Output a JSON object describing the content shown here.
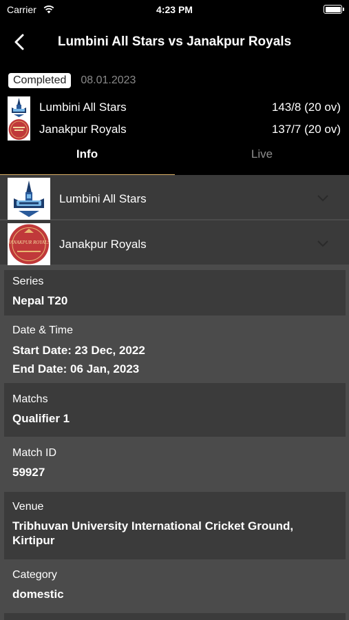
{
  "status_bar": {
    "carrier": "Carrier",
    "time": "4:23 PM"
  },
  "nav": {
    "title": "Lumbini All Stars vs Janakpur Royals"
  },
  "match": {
    "status": "Completed",
    "date": "08.01.2023",
    "teams": [
      {
        "name": "Lumbini All Stars",
        "score": "143/8 (20 ov)"
      },
      {
        "name": "Janakpur Royals",
        "score": "137/7 (20 ov)"
      }
    ]
  },
  "tabs": [
    {
      "label": "Info"
    },
    {
      "label": "Live"
    }
  ],
  "logos": {
    "janakpur_text": "JANAKPUR ROYALS"
  },
  "info": {
    "series_label": "Series",
    "series_value": "Nepal T20",
    "datetime_label": "Date & Time",
    "start_date": "Start Date: 23 Dec, 2022",
    "end_date": "End Date: 06 Jan, 2023",
    "matchs_label": "Matchs",
    "matchs_value": "Qualifier 1",
    "match_id_label": "Match ID",
    "match_id_value": "59927",
    "venue_label": "Venue",
    "venue_value": "Tribhuvan University International Cricket Ground, Kirtipur",
    "category_label": "Category",
    "category_value": "domestic"
  },
  "colors": {
    "tab_indicator": "#e0b46a",
    "background": "#000000",
    "panel": "#4b4b4b",
    "card": "#3b3b3b"
  }
}
